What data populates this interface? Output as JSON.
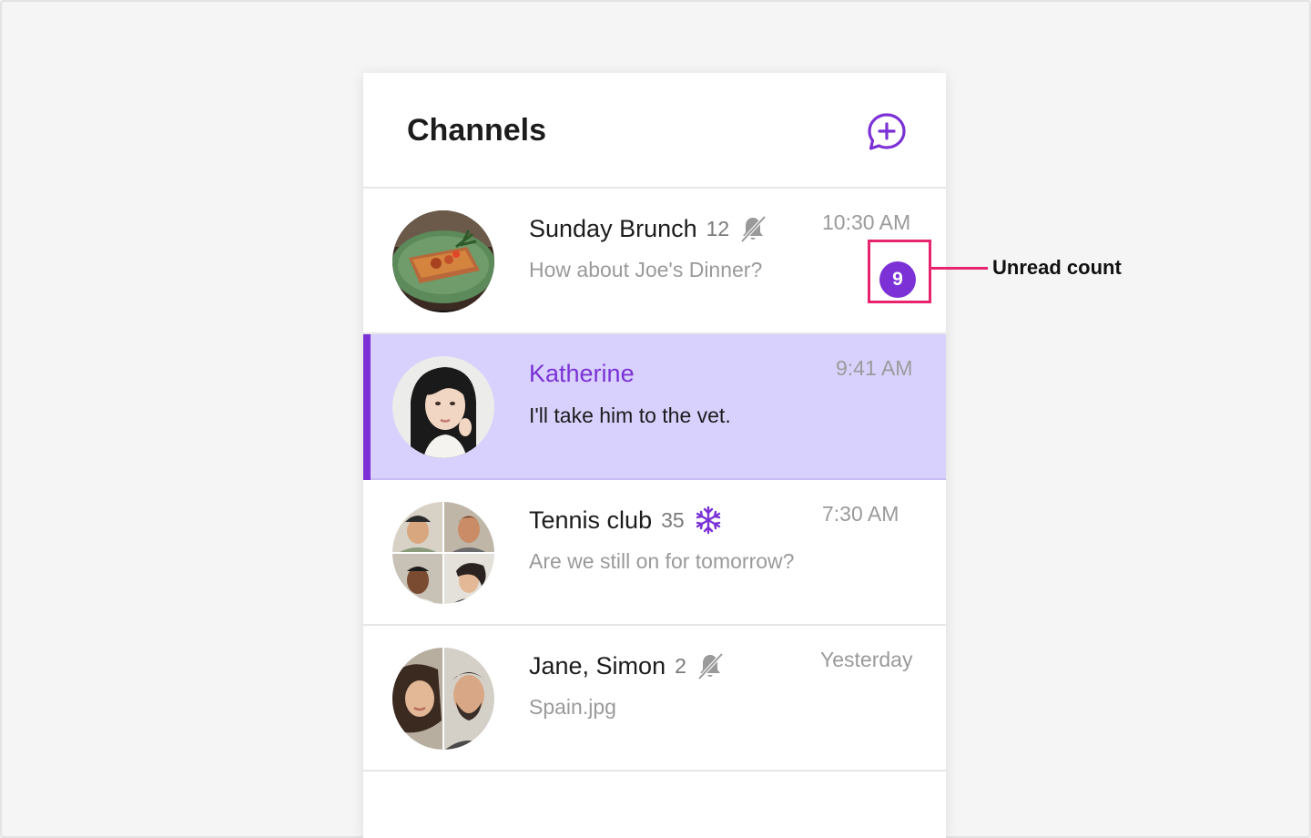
{
  "header": {
    "title": "Channels",
    "new_channel_icon": "chat-plus-icon"
  },
  "channels": [
    {
      "name": "Sunday Brunch",
      "members": "12",
      "status_icon": "muted-bell-icon",
      "time": "10:30 AM",
      "preview": "How about Joe's Dinner?",
      "unread": "9",
      "selected": false
    },
    {
      "name": "Katherine",
      "members": "",
      "status_icon": "",
      "time": "9:41 AM",
      "preview": "I'll take him to the vet.",
      "unread": "",
      "selected": true
    },
    {
      "name": "Tennis club",
      "members": "35",
      "status_icon": "frozen-snowflake-icon",
      "time": "7:30 AM",
      "preview": "Are we still on for tomorrow?",
      "unread": "",
      "selected": false
    },
    {
      "name": "Jane, Simon",
      "members": "2",
      "status_icon": "muted-bell-icon",
      "time": "Yesterday",
      "preview": "Spain.jpg",
      "unread": "",
      "selected": false
    }
  ],
  "annotation": {
    "label": "Unread count"
  },
  "colors": {
    "accent": "#7b31d6",
    "selected_bg": "#d9d1fd",
    "callout": "#e8246f",
    "muted_text": "#9a9a9a"
  }
}
